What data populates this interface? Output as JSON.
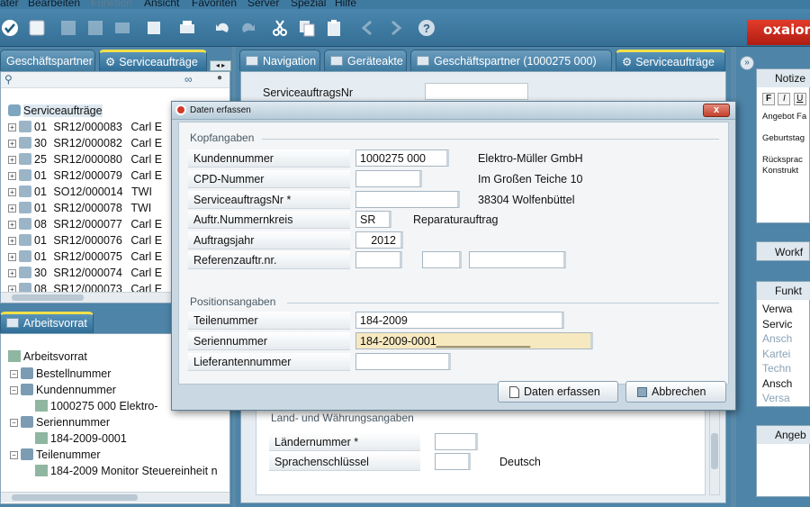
{
  "menubar": {
    "items": [
      "ater",
      "Bearbeiten",
      "Funktion",
      "Ansicht",
      "Favoriten",
      "Server",
      "Spezial",
      "Hilfe"
    ]
  },
  "toolbar": {
    "icons": [
      "check-icon",
      "square-icon",
      "save-icon",
      "save-all-icon",
      "print-icon",
      "print-preview-icon",
      "undo-icon",
      "redo-icon",
      "cut-icon",
      "copy-icon",
      "paste-icon",
      "back-icon",
      "forward-icon",
      "help-icon"
    ],
    "logo_text": "oxaion"
  },
  "left_panel": {
    "tabs": [
      {
        "label": "Geschäftspartner",
        "active": false
      },
      {
        "label": "Serviceaufträge",
        "active": true
      }
    ],
    "tree_root": "Serviceaufträge",
    "rows": [
      {
        "num": "01",
        "order": "SR12/000083",
        "name": "Carl E"
      },
      {
        "num": "30",
        "order": "SR12/000082",
        "name": "Carl E"
      },
      {
        "num": "25",
        "order": "SR12/000080",
        "name": "Carl E"
      },
      {
        "num": "01",
        "order": "SR12/000079",
        "name": "Carl E"
      },
      {
        "num": "01",
        "order": "SO12/000014",
        "name": "TWI"
      },
      {
        "num": "01",
        "order": "SR12/000078",
        "name": "TWI"
      },
      {
        "num": "08",
        "order": "SR12/000077",
        "name": "Carl E"
      },
      {
        "num": "01",
        "order": "SR12/000076",
        "name": "Carl E"
      },
      {
        "num": "01",
        "order": "SR12/000075",
        "name": "Carl E"
      },
      {
        "num": "30",
        "order": "SR12/000074",
        "name": "Carl E"
      },
      {
        "num": "08",
        "order": "SR12/000073",
        "name": "Carl E"
      }
    ]
  },
  "work_panel": {
    "tab": "Arbeitsvorrat",
    "root": "Arbeitsvorrat",
    "items": [
      {
        "label": "Bestellnummer",
        "level": 1,
        "kind": "folder"
      },
      {
        "label": "Kundennummer",
        "level": 1,
        "kind": "folder"
      },
      {
        "label": "1000275 000 Elektro-",
        "level": 2,
        "kind": "item"
      },
      {
        "label": "Seriennummer",
        "level": 1,
        "kind": "folder"
      },
      {
        "label": "184-2009-0001",
        "level": 2,
        "kind": "item"
      },
      {
        "label": "Teilenummer",
        "level": 1,
        "kind": "folder"
      },
      {
        "label": "184-2009 Monitor Steuereinheit n",
        "level": 2,
        "kind": "item"
      }
    ]
  },
  "center_panel": {
    "tabs": [
      {
        "label": "Navigation",
        "active": false
      },
      {
        "label": "Geräteakte",
        "active": false
      },
      {
        "label": "Geschäftspartner (1000275 000)",
        "active": false
      },
      {
        "label": "Serviceaufträge",
        "active": true
      }
    ],
    "top_label": "ServiceauftragsNr",
    "section_land": "Land- und Währungsangaben",
    "laendernummer_label": "Ländernummer *",
    "sprachenschluessel_label": "Sprachenschlüssel",
    "sprachenschluessel_value": "Deutsch"
  },
  "right_panel": {
    "notiz_title": "Notize",
    "format_buttons": [
      "F",
      "I",
      "U"
    ],
    "notiz_lines": [
      "Angebot Fa",
      "",
      "Geburtstag",
      "",
      "Rücksprac",
      "Konstrukt"
    ],
    "workflow_title": "Workf",
    "funktionen_title": "Funkt",
    "funktionen_items": [
      {
        "label": "Verwa",
        "enabled": true
      },
      {
        "label": "Servic",
        "enabled": true
      },
      {
        "label": "Ansch",
        "enabled": false
      },
      {
        "label": "Kartei",
        "enabled": false
      },
      {
        "label": "Techn",
        "enabled": false
      },
      {
        "label": "Ansch",
        "enabled": true
      },
      {
        "label": "Versa",
        "enabled": false
      }
    ],
    "angebot_title": "Angeb"
  },
  "dialog": {
    "title": "Daten erfassen",
    "close_label": "x",
    "section_kopf": "Kopfangaben",
    "section_pos": "Positionsangaben",
    "fields": {
      "kundennummer": {
        "label": "Kundennummer",
        "value": "1000275 000"
      },
      "cpd": {
        "label": "CPD-Nummer",
        "value": ""
      },
      "serviceauftragsnr": {
        "label": "ServiceauftragsNr *",
        "value": ""
      },
      "nummernkreis": {
        "label": "Auftr.Nummernkreis",
        "value": "SR"
      },
      "auftragsjahr": {
        "label": "Auftragsjahr",
        "value": "2012"
      },
      "referenz": {
        "label": "Referenzauftr.nr.",
        "value1": "",
        "value2": "",
        "value3": ""
      },
      "teilenummer": {
        "label": "Teilenummer",
        "value": "184-2009"
      },
      "seriennummer": {
        "label": "Seriennummer",
        "value": "184-2009-0001_______________"
      },
      "lieferantennummer": {
        "label": "Lieferantennummer",
        "value": ""
      }
    },
    "customer_name": "Elektro-Müller GmbH",
    "customer_street": "Im Großen Teiche 10",
    "customer_city": "38304 Wolfenbüttel",
    "nummernkreis_text": "Reparaturauftrag",
    "buttons": {
      "ok": "Daten erfassen",
      "cancel": "Abbrechen"
    }
  }
}
